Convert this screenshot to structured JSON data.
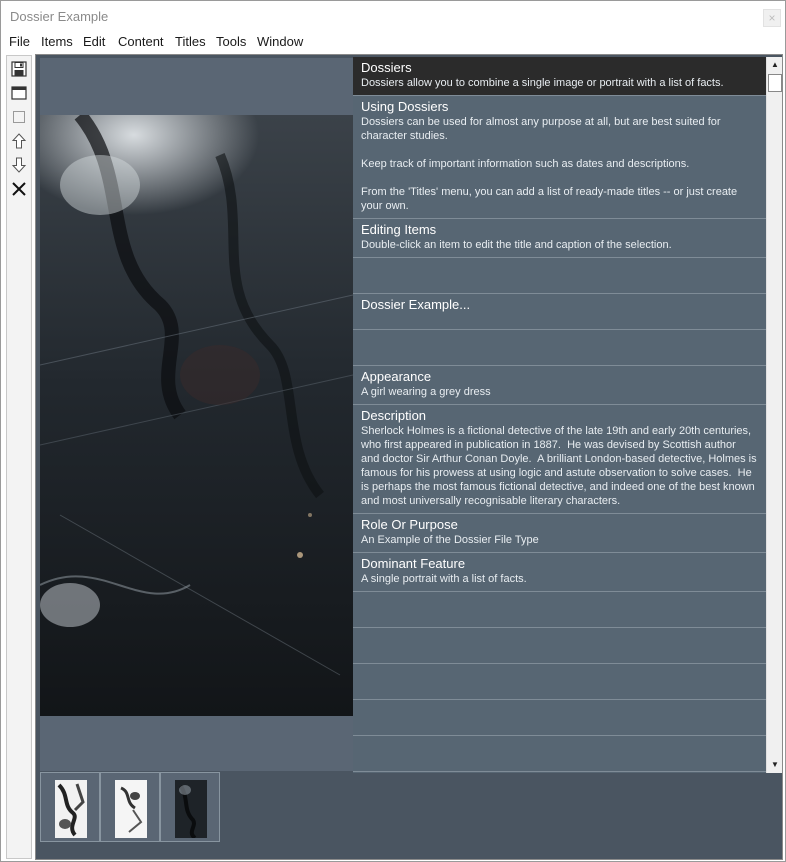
{
  "window": {
    "title": "Dossier Example",
    "close_glyph": "×"
  },
  "menu": [
    "File",
    "Items",
    "Edit",
    "Content",
    "Titles",
    "Tools",
    "Window"
  ],
  "toolbar": [
    {
      "icon": "save-icon"
    },
    {
      "icon": "window-icon"
    },
    {
      "icon": "blank-item-icon"
    },
    {
      "icon": "move-up-icon"
    },
    {
      "icon": "move-down-icon"
    },
    {
      "icon": "delete-icon"
    }
  ],
  "rows": [
    {
      "title": "Dossiers",
      "caption": "Dossiers allow you to combine a single image or portrait with a list of facts."
    },
    {
      "title": "Using Dossiers",
      "caption": "Dossiers can be used for almost any purpose at all, but are best suited for\ncharacter studies.\n\nKeep track of important information such as dates and descriptions.\n\nFrom the 'Titles' menu, you can add a list of ready-made titles -- or just create\nyour own."
    },
    {
      "title": "Editing Items",
      "caption": "Double-click an item to edit the title and caption of the selection."
    },
    {
      "title": "",
      "caption": ""
    },
    {
      "title": "Dossier Example...",
      "caption": ""
    },
    {
      "title": "",
      "caption": ""
    },
    {
      "title": "Appearance",
      "caption": "A girl wearing a grey dress"
    },
    {
      "title": "Description",
      "caption": "Sherlock Holmes is a fictional detective of the late 19th and early 20th centuries,\nwho first appeared in publication in 1887.  He was devised by Scottish author\nand doctor Sir Arthur Conan Doyle.  A brilliant London-based detective, Holmes is\nfamous for his prowess at using logic and astute observation to solve cases.  He\nis perhaps the most famous fictional detective, and indeed one of the best known\nand most universally recognisable literary characters."
    },
    {
      "title": "Role Or Purpose",
      "caption": "An Example of the Dossier File Type"
    },
    {
      "title": "Dominant Feature",
      "caption": "A single portrait with a list of facts."
    },
    {
      "title": "",
      "caption": ""
    },
    {
      "title": "",
      "caption": ""
    },
    {
      "title": "",
      "caption": ""
    },
    {
      "title": "",
      "caption": ""
    },
    {
      "title": "",
      "caption": ""
    }
  ],
  "selected_row": 0,
  "scrollbar": {
    "up_glyph": "▲",
    "down_glyph": "▼"
  },
  "thumbnails": [
    {
      "icon": "portrait-thumbnail-1"
    },
    {
      "icon": "portrait-thumbnail-2"
    },
    {
      "icon": "portrait-thumbnail-3"
    }
  ],
  "colors": {
    "list_bg": "#576673",
    "selected_bg": "#2b2b2b",
    "workspace_bg": "#4a5561"
  }
}
